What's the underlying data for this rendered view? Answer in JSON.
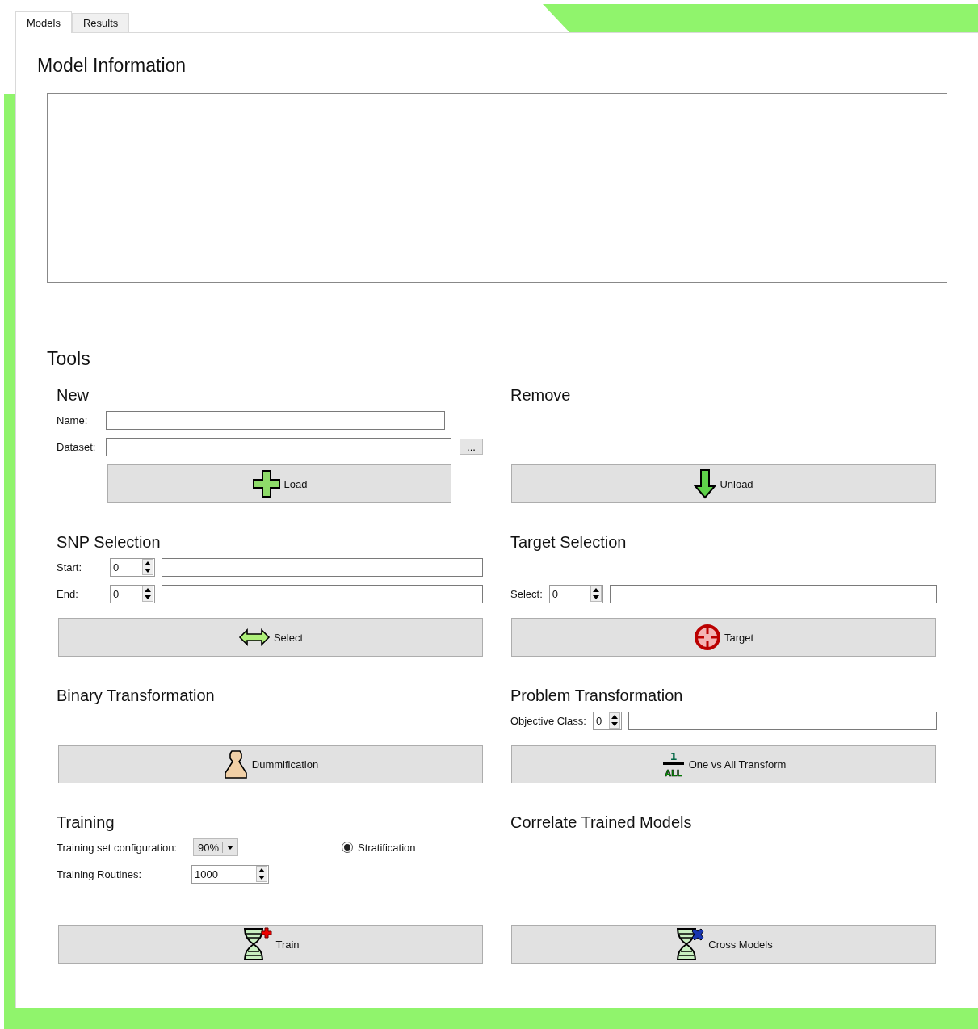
{
  "tabs": [
    {
      "label": "Models",
      "selected": true
    },
    {
      "label": "Results",
      "selected": false
    }
  ],
  "model_information": {
    "title": "Model Information"
  },
  "tools": {
    "title": "Tools",
    "sections": [
      {
        "title": "New",
        "rows": [
          {
            "kind": "text",
            "label": "Name:"
          },
          {
            "kind": "text",
            "label": "Dataset:",
            "browse": "..."
          }
        ],
        "button": {
          "label": "Load"
        }
      },
      {
        "title": "Remove",
        "button": {
          "label": "Unload"
        }
      },
      {
        "title": "SNP Selection",
        "rows": [
          {
            "kind": "spin-text",
            "label": "Start:",
            "value": "0"
          },
          {
            "kind": "spin-text",
            "label": "End:",
            "value": "0"
          }
        ],
        "button": {
          "label": "Select"
        }
      },
      {
        "title": "Target Selection",
        "rows": [
          {
            "kind": "spin-text",
            "label": "Select:",
            "value": "0"
          }
        ],
        "button": {
          "label": "Target"
        }
      },
      {
        "title": "Binary Transformation",
        "button": {
          "label": "Dummification"
        }
      },
      {
        "title": "Problem Transformation",
        "rows": [
          {
            "kind": "spin-text",
            "label": "Objective Class:",
            "value": "0"
          }
        ],
        "button": {
          "label": "One vs All Transform",
          "icon_text": [
            "1",
            "ALL"
          ]
        }
      },
      {
        "title": "Training",
        "rows": [
          {
            "kind": "combo",
            "label": "Training set configuration:",
            "value": "90%",
            "radio": {
              "label": "Stratification",
              "selected": true
            }
          },
          {
            "kind": "spin",
            "label": "Training Routines:",
            "value": "1000"
          }
        ],
        "button": {
          "label": "Train"
        }
      },
      {
        "title": "Correlate Trained Models",
        "button": {
          "label": "Cross Models"
        }
      }
    ]
  }
}
